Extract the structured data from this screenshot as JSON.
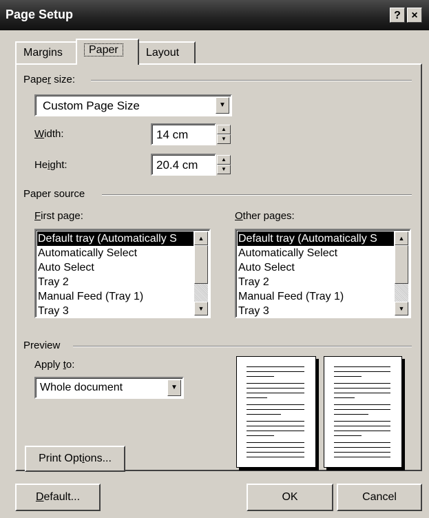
{
  "window": {
    "title": "Page Setup",
    "help_label": "?",
    "close_label": "×"
  },
  "tabs": [
    {
      "label": "Margins"
    },
    {
      "label": "Paper"
    },
    {
      "label": "Layout"
    }
  ],
  "paper_size": {
    "group_label_pre": "Pape",
    "group_label_u": "r",
    "group_label_post": " size:",
    "selected": "Custom Page Size",
    "width_label_u": "W",
    "width_label_post": "idth:",
    "width_value": "14 cm",
    "height_label_pre": "He",
    "height_label_u": "i",
    "height_label_post": "ght:",
    "height_value": "20.4 cm"
  },
  "paper_source": {
    "group_label": "Paper source",
    "first_label_u": "F",
    "first_label_post": "irst page:",
    "other_label_u": "O",
    "other_label_post": "ther pages:",
    "first_items": [
      "Default tray (Automatically S",
      "Automatically Select",
      "Auto Select",
      "Tray 2",
      "Manual Feed (Tray 1)",
      "Tray 3"
    ],
    "other_items": [
      "Default tray (Automatically S",
      "Automatically Select",
      "Auto Select",
      "Tray 2",
      "Manual Feed (Tray 1)",
      "Tray 3"
    ]
  },
  "preview": {
    "group_label": "Preview",
    "apply_label_pre": "Apply ",
    "apply_label_u": "t",
    "apply_label_post": "o:",
    "apply_selected": "Whole document",
    "print_options_pre": "Print Opt",
    "print_options_u": "i",
    "print_options_post": "ons..."
  },
  "footer": {
    "default_u": "D",
    "default_post": "efault...",
    "ok_label": "OK",
    "cancel_label": "Cancel"
  },
  "icons": {
    "down": "▼",
    "up": "▲"
  }
}
